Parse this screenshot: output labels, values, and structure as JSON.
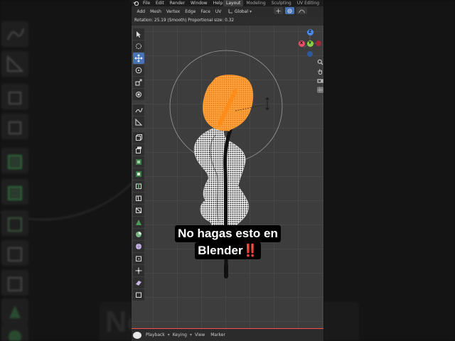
{
  "topbar": {
    "menus": [
      "File",
      "Edit",
      "Render",
      "Window",
      "Help"
    ],
    "workspace_tabs": [
      {
        "label": "Layout",
        "active": true
      },
      {
        "label": "Modeling",
        "active": false
      },
      {
        "label": "Sculpting",
        "active": false
      },
      {
        "label": "UV Editing",
        "active": false
      }
    ]
  },
  "header": {
    "menus": [
      "Add",
      "Mesh",
      "Vertex",
      "Edge",
      "Face",
      "UV"
    ],
    "orientation": "Global"
  },
  "operator_status": "Rotation: 25.19 (Smooth) Proportional size: 0.32",
  "toolbar": {
    "tools": [
      "select-box",
      "cursor",
      "move",
      "rotate",
      "scale",
      "transform",
      "annotate",
      "measure",
      "add-cube",
      "extrude",
      "inset",
      "bevel",
      "loop-cut",
      "knife",
      "poly-build",
      "spin",
      "smooth",
      "edge-slide",
      "shrink-fatten",
      "shear",
      "rip"
    ],
    "active_tool": "move"
  },
  "gizmo": {
    "axes": [
      "Z",
      "X",
      "Y"
    ]
  },
  "timeline": {
    "menus": [
      "Playback",
      "Keying",
      "View",
      "Marker"
    ]
  },
  "caption": {
    "line1": "No hagas esto en",
    "line2_text": "Blender",
    "line2_emoji": "‼️"
  },
  "background_caption": "No hagas esto en",
  "colors": {
    "accent": "#4772b3",
    "selection": "#ff8c1a",
    "caption_bg": "#000000",
    "emoji_red": "#ff2a2a"
  }
}
